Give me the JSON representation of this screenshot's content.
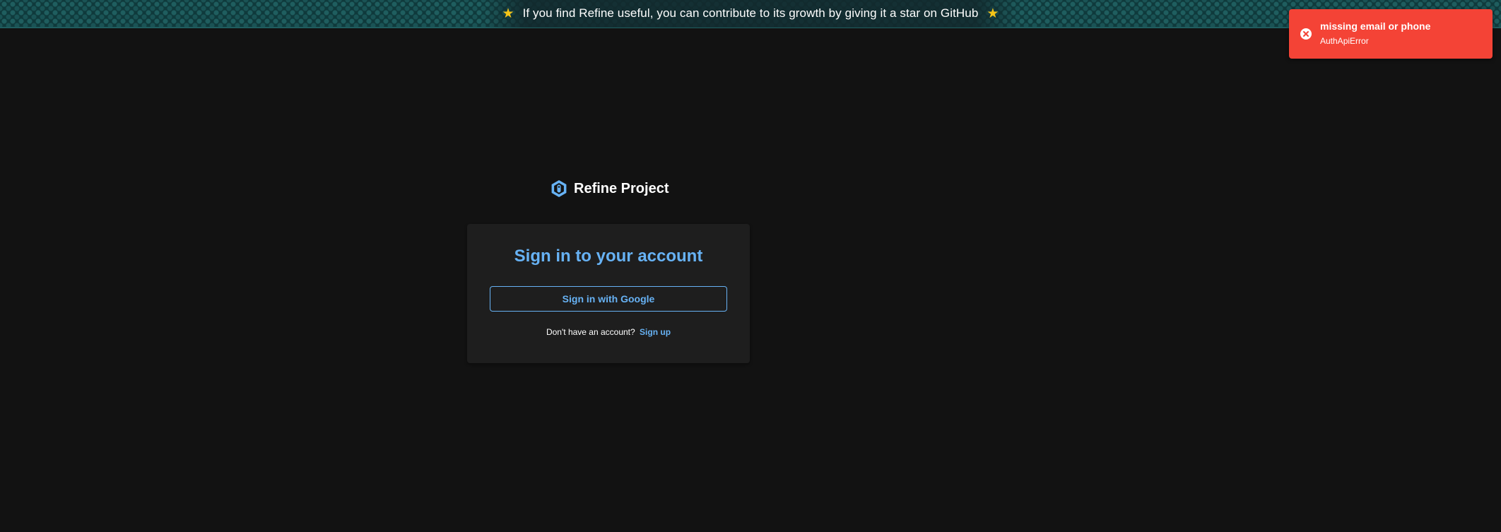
{
  "banner": {
    "text": "If you find Refine useful, you can contribute to its growth by giving it a star on GitHub",
    "left_icon": "star-icon",
    "right_icon": "star-icon",
    "star_color": "#f5c518"
  },
  "toast": {
    "title": "missing email or phone",
    "description": "AuthApiError",
    "icon": "error-circle-icon",
    "background": "#f44336"
  },
  "brand": {
    "name": "Refine Project",
    "icon": "refine-logo-icon"
  },
  "login": {
    "title": "Sign in to your account",
    "google_button_label": "Sign in with Google",
    "no_account_text": "Don't have an account?",
    "signup_link": "Sign up",
    "accent_color": "#67b2f4"
  }
}
